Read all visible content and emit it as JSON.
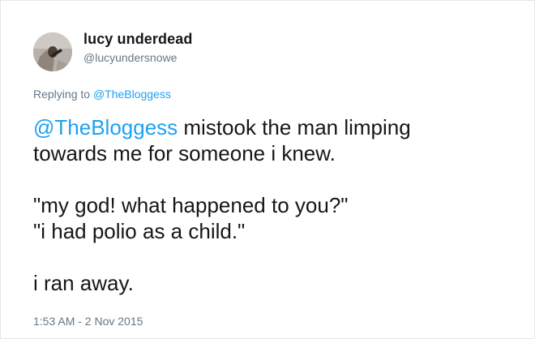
{
  "author": {
    "display_name": "lucy underdead",
    "handle": "@lucyundersnowe"
  },
  "reply": {
    "prefix": "Replying to ",
    "to_handle": "@TheBloggess"
  },
  "tweet": {
    "mention": "@TheBloggess",
    "line1_rest": " mistook the man limping",
    "line2": "towards me for someone i knew.",
    "line3": "\"my god! what happened to you?\"",
    "line4": "\"i had polio as a child.\"",
    "line5": "i ran away."
  },
  "timestamp": "1:53 AM - 2 Nov 2015",
  "colors": {
    "link": "#1da1f2",
    "text": "#14171a",
    "muted": "#657786",
    "border": "#e1e8ed"
  }
}
